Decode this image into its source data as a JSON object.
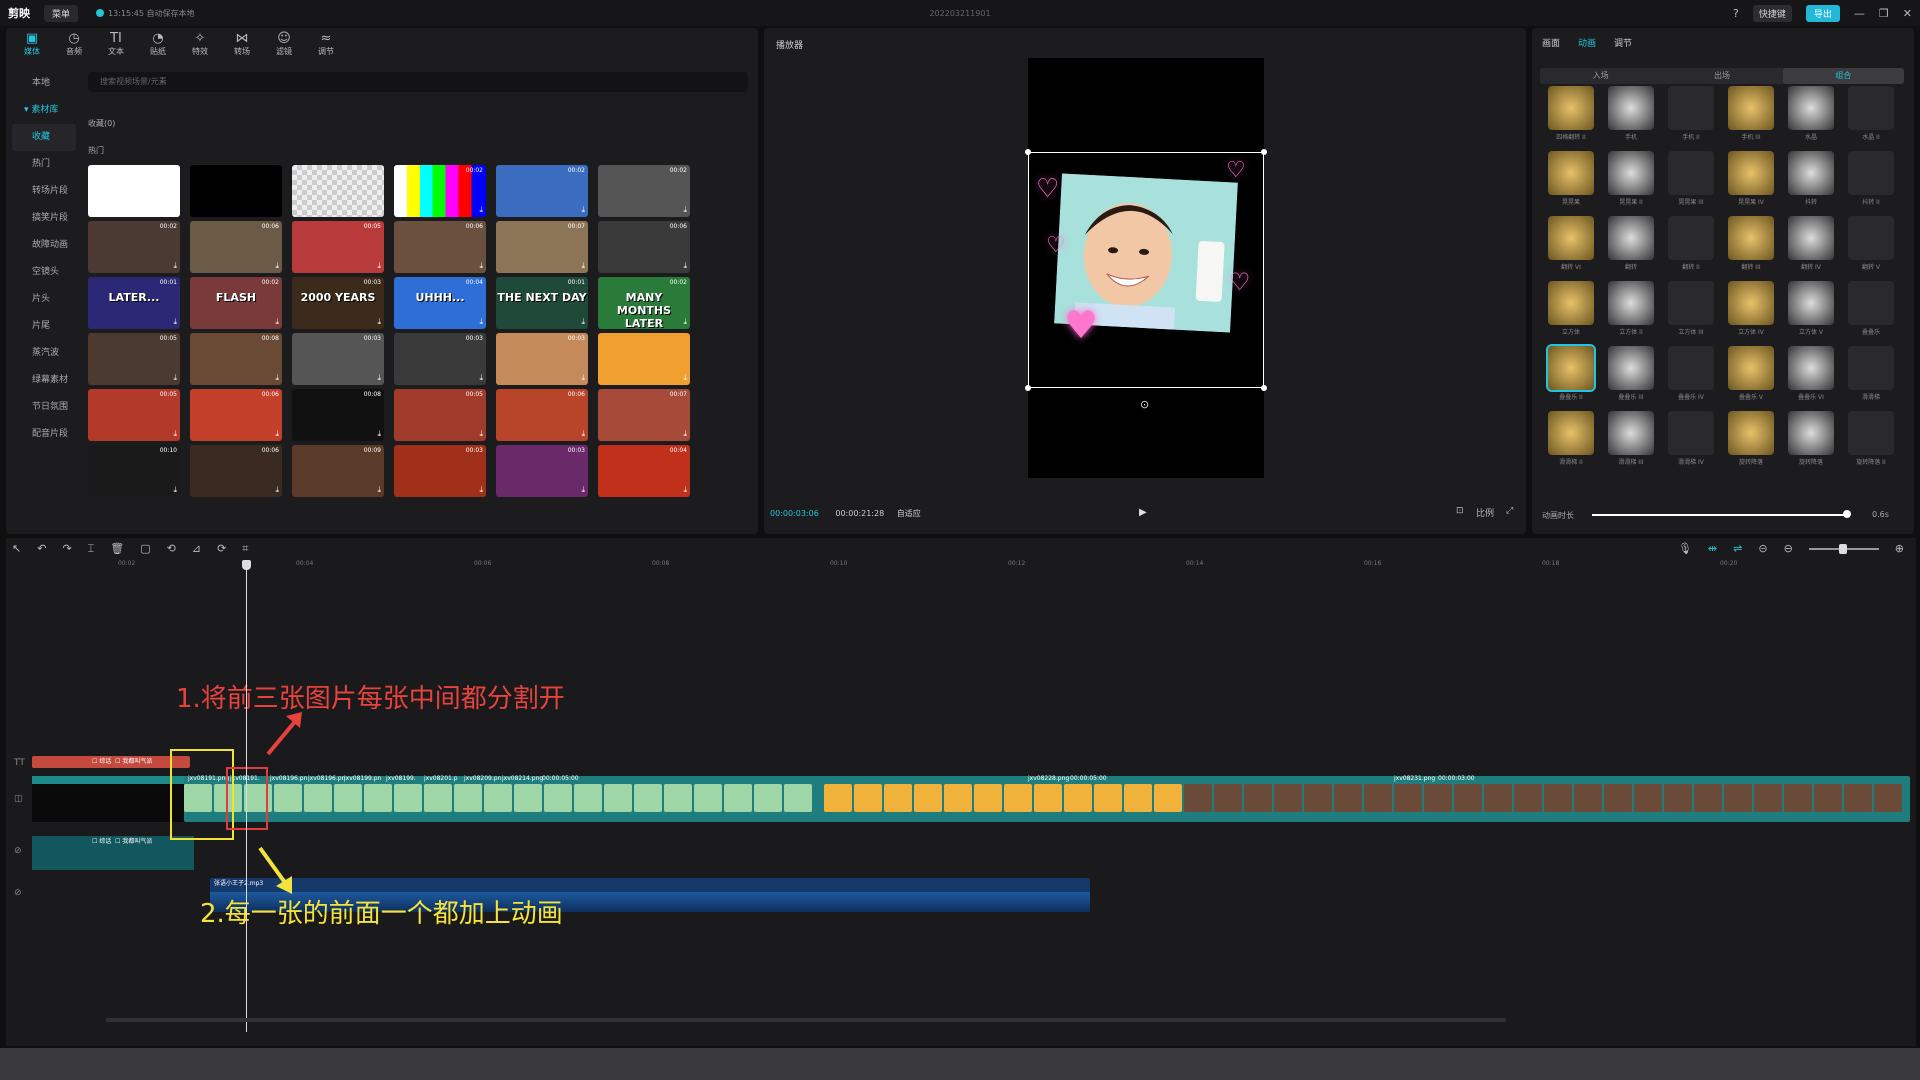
{
  "titlebar": {
    "app_name": "剪映",
    "menu_label": "菜单",
    "autosave": "13:15:45 自动保存本地",
    "project_name": "202203211901",
    "shortcut_label": "快捷键",
    "export_label": "导出"
  },
  "media": {
    "tabs": [
      {
        "icon": "▣",
        "label": "媒体"
      },
      {
        "icon": "◷",
        "label": "音频"
      },
      {
        "icon": "TI",
        "label": "文本"
      },
      {
        "icon": "◔",
        "label": "贴纸"
      },
      {
        "icon": "✧",
        "label": "特效"
      },
      {
        "icon": "⋈",
        "label": "转场"
      },
      {
        "icon": "☺",
        "label": "滤镜"
      },
      {
        "icon": "≈",
        "label": "调节"
      }
    ],
    "side_top": "本地",
    "side_parent": "素材库",
    "side_items": [
      "收藏",
      "热门",
      "转场片段",
      "搞笑片段",
      "故障动画",
      "空镜头",
      "片头",
      "片尾",
      "蒸汽波",
      "绿幕素材",
      "节日氛围",
      "配音片段"
    ],
    "search_placeholder": "搜索视频场景/元素",
    "favorites_label": "收藏(0)",
    "hot_label": "热门",
    "thumbs": [
      {
        "dur": "",
        "color": "#ffffff",
        "cap": ""
      },
      {
        "dur": "",
        "color": "#000000",
        "cap": ""
      },
      {
        "dur": "",
        "color": "#d8d8d8",
        "cap": ""
      },
      {
        "dur": "00:02",
        "color": "#8a6fd1",
        "cap": ""
      },
      {
        "dur": "00:02",
        "color": "#3a6dc0",
        "cap": ""
      },
      {
        "dur": "00:02",
        "color": "#555555",
        "cap": ""
      },
      {
        "dur": "00:02",
        "color": "#4a3a33",
        "cap": ""
      },
      {
        "dur": "00:06",
        "color": "#6b5a45",
        "cap": ""
      },
      {
        "dur": "00:05",
        "color": "#b83a3a",
        "cap": ""
      },
      {
        "dur": "00:06",
        "color": "#6b5040",
        "cap": ""
      },
      {
        "dur": "00:07",
        "color": "#8c7456",
        "cap": ""
      },
      {
        "dur": "00:06",
        "color": "#3a3a3a",
        "cap": ""
      },
      {
        "dur": "00:01",
        "color": "#2b2875",
        "cap": "LATER..."
      },
      {
        "dur": "00:02",
        "color": "#7a3a3a",
        "cap": "FLASH"
      },
      {
        "dur": "00:03",
        "color": "#3c2a1a",
        "cap": "2000 YEARS"
      },
      {
        "dur": "00:04",
        "color": "#2d6fd6",
        "cap": "UHHH..."
      },
      {
        "dur": "00:01",
        "color": "#1f4a3a",
        "cap": "THE NEXT DAY"
      },
      {
        "dur": "00:02",
        "color": "#2a7a3a",
        "cap": "MANY MONTHS LATER"
      },
      {
        "dur": "00:05",
        "color": "#4a3a30",
        "cap": ""
      },
      {
        "dur": "00:08",
        "color": "#6a4a35",
        "cap": ""
      },
      {
        "dur": "00:03",
        "color": "#555555",
        "cap": ""
      },
      {
        "dur": "00:03",
        "color": "#3a3a3a",
        "cap": ""
      },
      {
        "dur": "00:03",
        "color": "#c48a5a",
        "cap": ""
      },
      {
        "dur": "",
        "color": "#f0a030",
        "cap": ""
      },
      {
        "dur": "00:05",
        "color": "#b23a2a",
        "cap": ""
      },
      {
        "dur": "00:06",
        "color": "#c2402a",
        "cap": ""
      },
      {
        "dur": "00:08",
        "color": "#111111",
        "cap": ""
      },
      {
        "dur": "00:05",
        "color": "#a03a2a",
        "cap": ""
      },
      {
        "dur": "00:06",
        "color": "#b8442a",
        "cap": ""
      },
      {
        "dur": "00:07",
        "color": "#a84a3a",
        "cap": ""
      },
      {
        "dur": "00:10",
        "color": "#1a1a1a",
        "cap": ""
      },
      {
        "dur": "00:06",
        "color": "#3a2a20",
        "cap": ""
      },
      {
        "dur": "00:09",
        "color": "#5a3a28",
        "cap": ""
      },
      {
        "dur": "00:03",
        "color": "#a0301a",
        "cap": ""
      },
      {
        "dur": "00:03",
        "color": "#6a2a6a",
        "cap": ""
      },
      {
        "dur": "00:04",
        "color": "#c0301a",
        "cap": ""
      }
    ]
  },
  "player": {
    "title": "播放器",
    "current_time": "00:00:03:06",
    "total_time": "00:00:21:28",
    "mode": "自适应",
    "aspect_ratio": "比例"
  },
  "right": {
    "tabs": [
      "画面",
      "动画",
      "调节"
    ],
    "active_tab": "动画",
    "subtabs": [
      "入场",
      "出场",
      "组合"
    ],
    "active_subtab": "组合",
    "anims": [
      "四格翻转 II",
      "手机",
      "手机 II",
      "手机 III",
      "水晶",
      "水晶 II",
      "晃晃果",
      "晃晃果 II",
      "晃晃果 III",
      "晃晃果 IV",
      "抖转",
      "抖转 II",
      "翻转 VI",
      "翻转",
      "翻转 II",
      "翻转 III",
      "翻转 IV",
      "翻转 V",
      "立方体",
      "立方体 II",
      "立方体 III",
      "立方体 IV",
      "立方体 V",
      "叠叠乐",
      "叠叠乐 II",
      "叠叠乐 III",
      "叠叠乐 IV",
      "叠叠乐 V",
      "叠叠乐 VI",
      "滑滑梯",
      "滑滑梯 II",
      "滑滑梯 III",
      "滑滑梯 IV",
      "旋转降落",
      "旋转降落",
      "旋转降落 II"
    ],
    "duration_label": "动画时长",
    "duration_value": "0.6s",
    "duration_fraction": 0.95
  },
  "timeline": {
    "ruler": [
      "00:02",
      "00:04",
      "00:06",
      "00:08",
      "00:10",
      "00:12",
      "00:14",
      "00:16",
      "00:18",
      "00:20"
    ],
    "text_clip_labels": [
      "☐ 综话",
      "☐ 我都叫气派"
    ],
    "audio_a_labels": [
      "☐ 综话",
      "☐ 我都叫气派"
    ],
    "clip_labels": [
      "jxv08191.png",
      "jxv08191.",
      "jxv08196.pn",
      "jxv08196.pn",
      "jxv08199.pn",
      "jxv08199.",
      "jxv08201.p",
      "jxv08209.pn",
      "jxv08214.png",
      "00:00:05:00",
      "jxv08228.png",
      "00:00:05:00",
      "jxv08231.png",
      "00:00:03:00"
    ],
    "audio_name": "张语小王子2.mp3",
    "note1": "1.将前三张图片每张中间都分割开",
    "note2": "2.每一张的前面一个都加上动画"
  }
}
